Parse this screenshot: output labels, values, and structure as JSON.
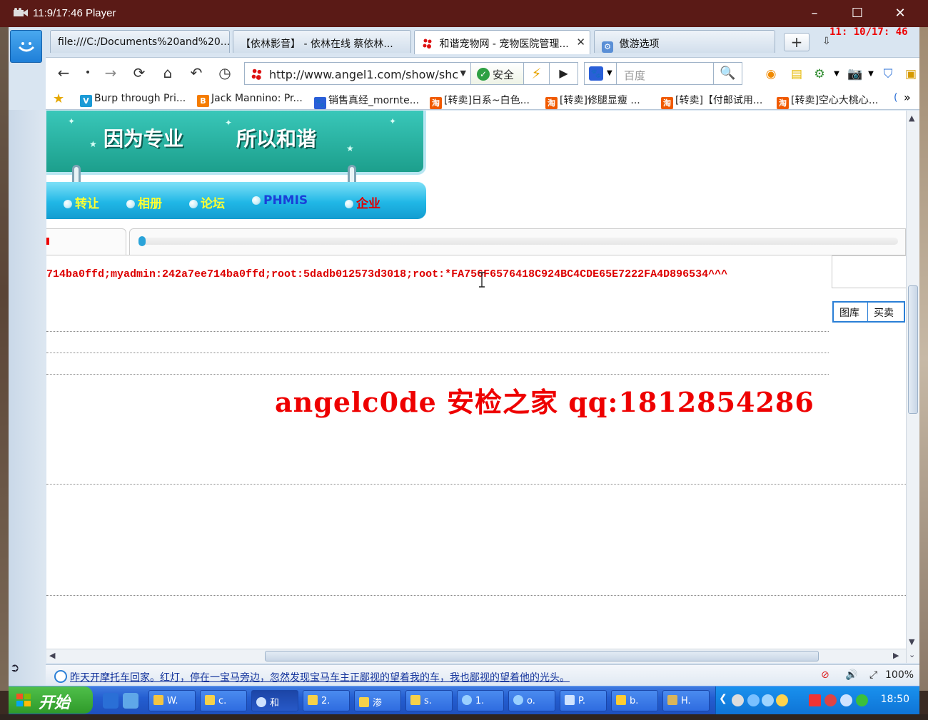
{
  "player": {
    "title": "11:9/17:46 Player",
    "minimize": "–",
    "maximize": "☐",
    "close": "✕"
  },
  "tabs": [
    {
      "label": "file:///C:/Documents%20and%20..."
    },
    {
      "label": "【依林影音】 - 依林在线 蔡依林..."
    },
    {
      "label": "和谐宠物网 - 宠物医院管理...",
      "close": "✕"
    },
    {
      "label": "傲游选项"
    }
  ],
  "tab_overlay_clock": "11: 10/17: 46",
  "newtab": "+",
  "nav": {
    "url": "http://www.angel1.com/show/shc",
    "secure_label": "安全",
    "search_placeholder": "百度"
  },
  "favorites": [
    {
      "label": "Burp through Pri..."
    },
    {
      "label": "Jack Mannino: Pr..."
    },
    {
      "label": "销售真经_mornte..."
    },
    {
      "label": "[转卖]日系~白色..."
    },
    {
      "label": "[转卖]修腿显瘦 ..."
    },
    {
      "label": "[转卖]【付邮试用..."
    },
    {
      "label": "[转卖]空心大桃心..."
    }
  ],
  "favorites_more": "»",
  "page": {
    "slogan_left": "因为专业",
    "slogan_right": "所以和谐",
    "menu": [
      {
        "label": "转让",
        "color": "#ffff33"
      },
      {
        "label": "相册",
        "color": "#ffff33"
      },
      {
        "label": "论坛",
        "color": "#ffff33"
      },
      {
        "label": "PHMIS",
        "color": "#1a3fd8"
      },
      {
        "label": "企业",
        "color": "#e00000"
      }
    ],
    "dump_text": "714ba0ffd;myadmin:242a7ee714ba0ffd;root:5dadb012573d3018;root:*FA756F6576418C924BC4CDE65E7222FA4D896534^^^",
    "mini_tabs": [
      "图库",
      "买卖"
    ],
    "watermark": "angelc0de  安检之家  qq:1812854286"
  },
  "status": {
    "ticker": "昨天开摩托车回家。红灯，停在一宝马旁边，忽然发现宝马车主正鄙视的望着我的车，我也鄙视的望着他的光头。",
    "zoom": "100%"
  },
  "taskbar": {
    "start": "开始",
    "items": [
      {
        "label": "W.",
        "color": "#f4c542"
      },
      {
        "label": "c.",
        "color": "#f6d14a"
      },
      {
        "label": "和",
        "color": "#cfe3ff"
      },
      {
        "label": "2.",
        "color": "#f6d14a"
      },
      {
        "label": "渗",
        "color": "#f6d14a"
      },
      {
        "label": "s.",
        "color": "#f6d14a"
      },
      {
        "label": "1.",
        "color": "#9ad0ff"
      },
      {
        "label": "o.",
        "color": "#9ad0ff"
      },
      {
        "label": "P.",
        "color": "#cfe3ff"
      },
      {
        "label": "b.",
        "color": "#ffcc33"
      },
      {
        "label": "H.",
        "color": "#d9b45a"
      }
    ],
    "clock": "18:50"
  }
}
